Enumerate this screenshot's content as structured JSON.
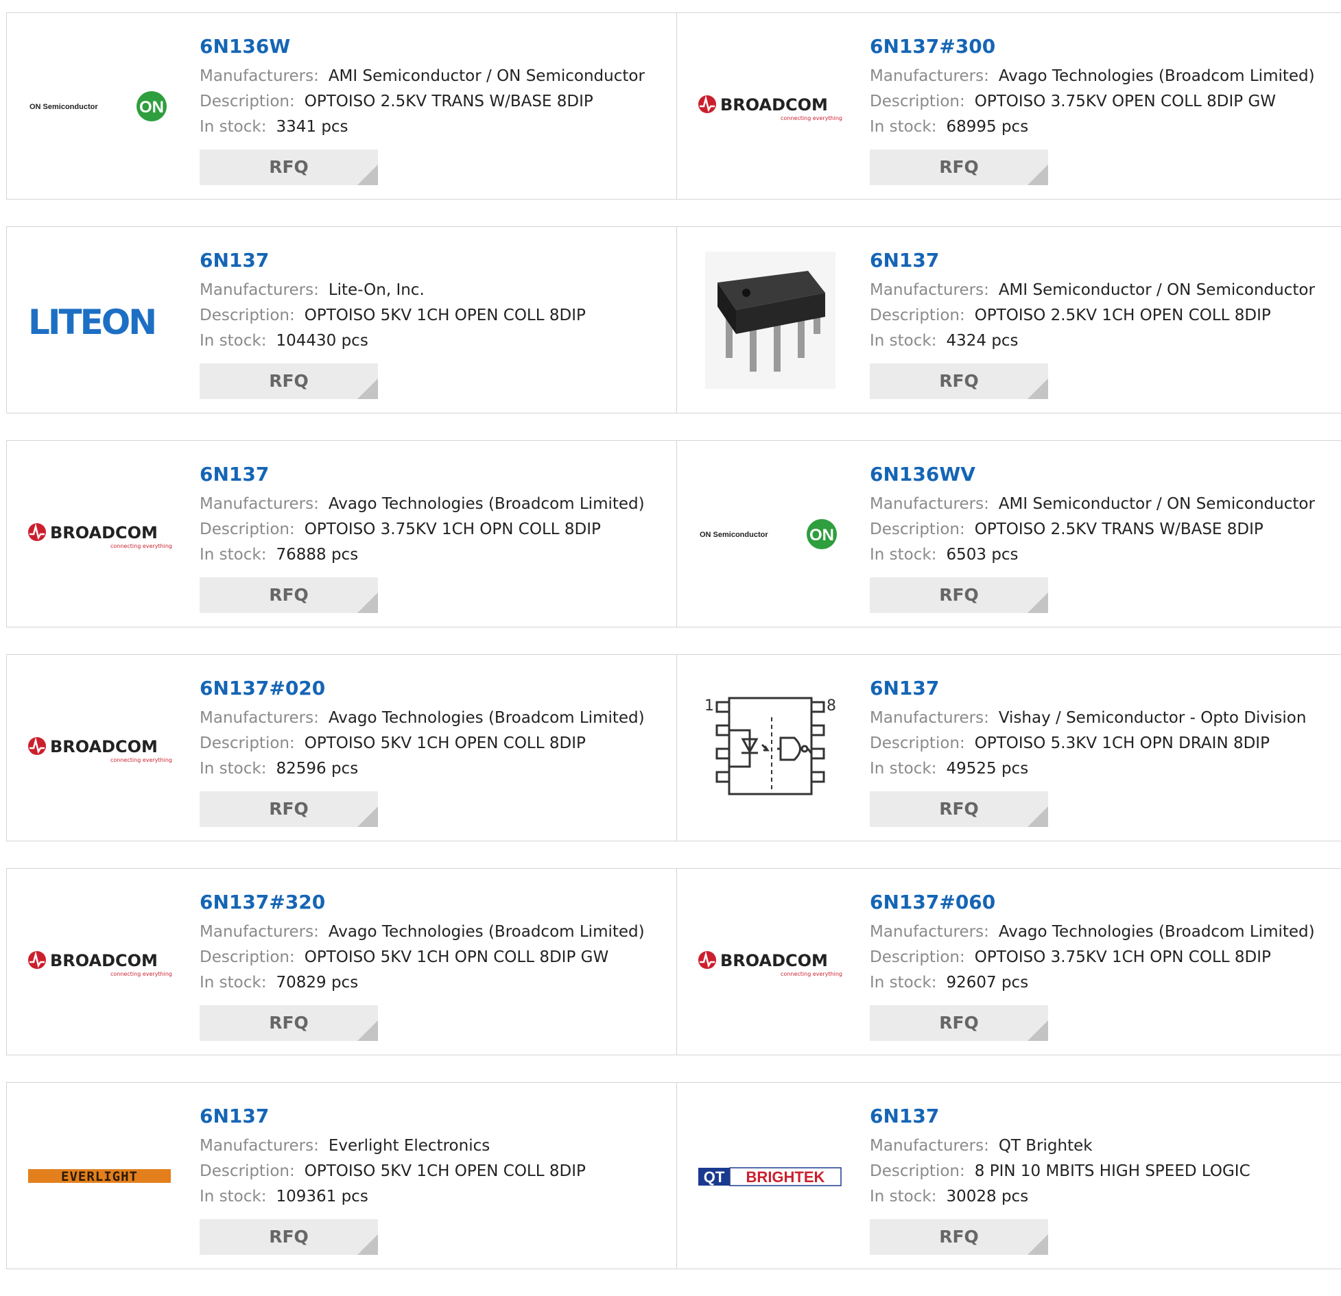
{
  "labels": {
    "manufacturers": "Manufacturers:",
    "description": "Description:",
    "in_stock": "In stock:",
    "rfq": "RFQ"
  },
  "products": [
    {
      "part": "6N136W",
      "manufacturer": "AMI Semiconductor / ON Semiconductor",
      "description": "OPTOISO 2.5KV TRANS W/BASE 8DIP",
      "stock": "3341 pcs",
      "logo": "on-semi"
    },
    {
      "part": "6N137#300",
      "manufacturer": "Avago Technologies (Broadcom Limited)",
      "description": "OPTOISO 3.75KV OPEN COLL 8DIP GW",
      "stock": "68995 pcs",
      "logo": "broadcom"
    },
    {
      "part": "6N137",
      "manufacturer": "Lite-On, Inc.",
      "description": "OPTOISO 5KV 1CH OPEN COLL 8DIP",
      "stock": "104430 pcs",
      "logo": "liteon"
    },
    {
      "part": "6N137",
      "manufacturer": "AMI Semiconductor / ON Semiconductor",
      "description": "OPTOISO 2.5KV 1CH OPEN COLL 8DIP",
      "stock": "4324 pcs",
      "logo": "dip-chip"
    },
    {
      "part": "6N137",
      "manufacturer": "Avago Technologies (Broadcom Limited)",
      "description": "OPTOISO 3.75KV 1CH OPN COLL 8DIP",
      "stock": "76888 pcs",
      "logo": "broadcom"
    },
    {
      "part": "6N136WV",
      "manufacturer": "AMI Semiconductor / ON Semiconductor",
      "description": "OPTOISO 2.5KV TRANS W/BASE 8DIP",
      "stock": "6503 pcs",
      "logo": "on-semi"
    },
    {
      "part": "6N137#020",
      "manufacturer": "Avago Technologies (Broadcom Limited)",
      "description": "OPTOISO 5KV 1CH OPEN COLL 8DIP",
      "stock": "82596 pcs",
      "logo": "broadcom"
    },
    {
      "part": "6N137",
      "manufacturer": "Vishay / Semiconductor - Opto Division",
      "description": "OPTOISO 5.3KV 1CH OPN DRAIN 8DIP",
      "stock": "49525 pcs",
      "logo": "schematic"
    },
    {
      "part": "6N137#320",
      "manufacturer": "Avago Technologies (Broadcom Limited)",
      "description": "OPTOISO 5KV 1CH OPN COLL 8DIP GW",
      "stock": "70829 pcs",
      "logo": "broadcom"
    },
    {
      "part": "6N137#060",
      "manufacturer": "Avago Technologies (Broadcom Limited)",
      "description": "OPTOISO 3.75KV 1CH OPN COLL 8DIP",
      "stock": "92607 pcs",
      "logo": "broadcom"
    },
    {
      "part": "6N137",
      "manufacturer": "Everlight Electronics",
      "description": "OPTOISO 5KV 1CH OPEN COLL 8DIP",
      "stock": "109361 pcs",
      "logo": "everlight"
    },
    {
      "part": "6N137",
      "manufacturer": "QT Brightek",
      "description": "8 PIN 10 MBITS HIGH SPEED LOGIC",
      "stock": "30028 pcs",
      "logo": "qt-brightek"
    }
  ],
  "logo_text": {
    "on_semi": "ON Semiconductor",
    "on_badge": "ON",
    "broadcom": "BROADCOM",
    "broadcom_tag": "connecting everything",
    "liteon": "LITEON",
    "everlight": "EVERLIGHT",
    "qt": "QT",
    "brightek": "BRIGHTEK",
    "pin1": "1",
    "pin8": "8"
  },
  "colors": {
    "part_link": "#1565b5",
    "label_gray": "#8a8a8a",
    "button_bg": "#ebebeb",
    "on_green": "#2e9e3e",
    "broadcom_red": "#cc1f2d",
    "liteon_blue": "#1d6fc4",
    "everlight_orange": "#e37f1c",
    "qt_navy": "#1a3a8f"
  }
}
